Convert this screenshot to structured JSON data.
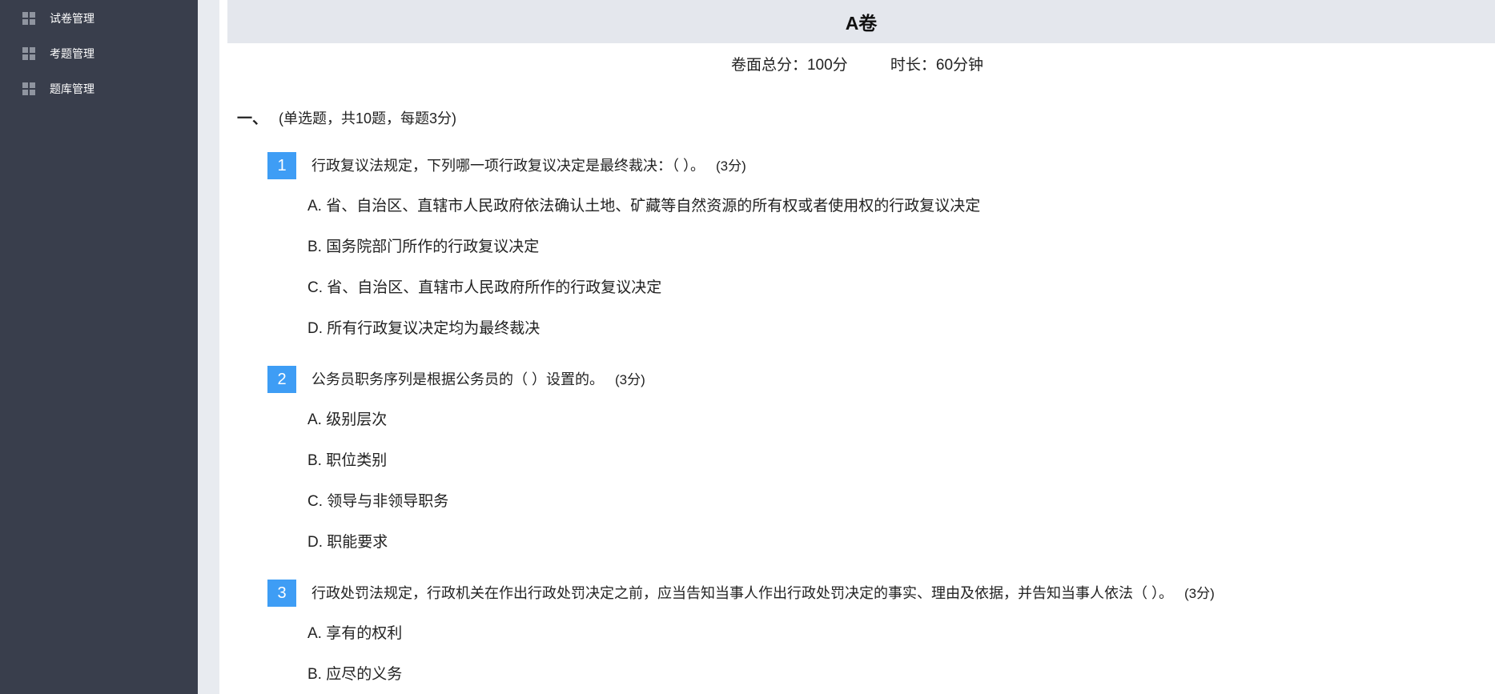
{
  "sidebar": {
    "items": [
      {
        "label": "试卷管理",
        "icon": "grid-icon"
      },
      {
        "label": "考题管理",
        "icon": "grid-icon"
      },
      {
        "label": "题库管理",
        "icon": "grid-icon"
      }
    ]
  },
  "paper": {
    "title": "A卷",
    "total_score": "卷面总分：100分",
    "duration": "时长：60分钟"
  },
  "section": {
    "number": "一、",
    "description": "(单选题，共10题，每题3分)"
  },
  "questions": [
    {
      "number": "1",
      "text": "行政复议法规定，下列哪一项行政复议决定是最终裁决：（ ）。",
      "score": "(3分)",
      "options": [
        "A. 省、自治区、直辖市人民政府依法确认土地、矿藏等自然资源的所有权或者使用权的行政复议决定",
        "B. 国务院部门所作的行政复议决定",
        "C. 省、自治区、直辖市人民政府所作的行政复议决定",
        "D. 所有行政复议决定均为最终裁决"
      ]
    },
    {
      "number": "2",
      "text": "公务员职务序列是根据公务员的（ ）设置的。",
      "score": "(3分)",
      "options": [
        "A. 级别层次",
        "B. 职位类别",
        "C. 领导与非领导职务",
        "D. 职能要求"
      ]
    },
    {
      "number": "3",
      "text": "行政处罚法规定，行政机关在作出行政处罚决定之前，应当告知当事人作出行政处罚决定的事实、理由及依据，并告知当事人依法（ ）。",
      "score": "(3分)",
      "options": [
        "A. 享有的权利",
        "B. 应尽的义务"
      ]
    }
  ],
  "colors": {
    "sidebar_bg": "#393e4c",
    "accent": "#3e9df5",
    "title_bar_bg": "#e4e7ed"
  }
}
